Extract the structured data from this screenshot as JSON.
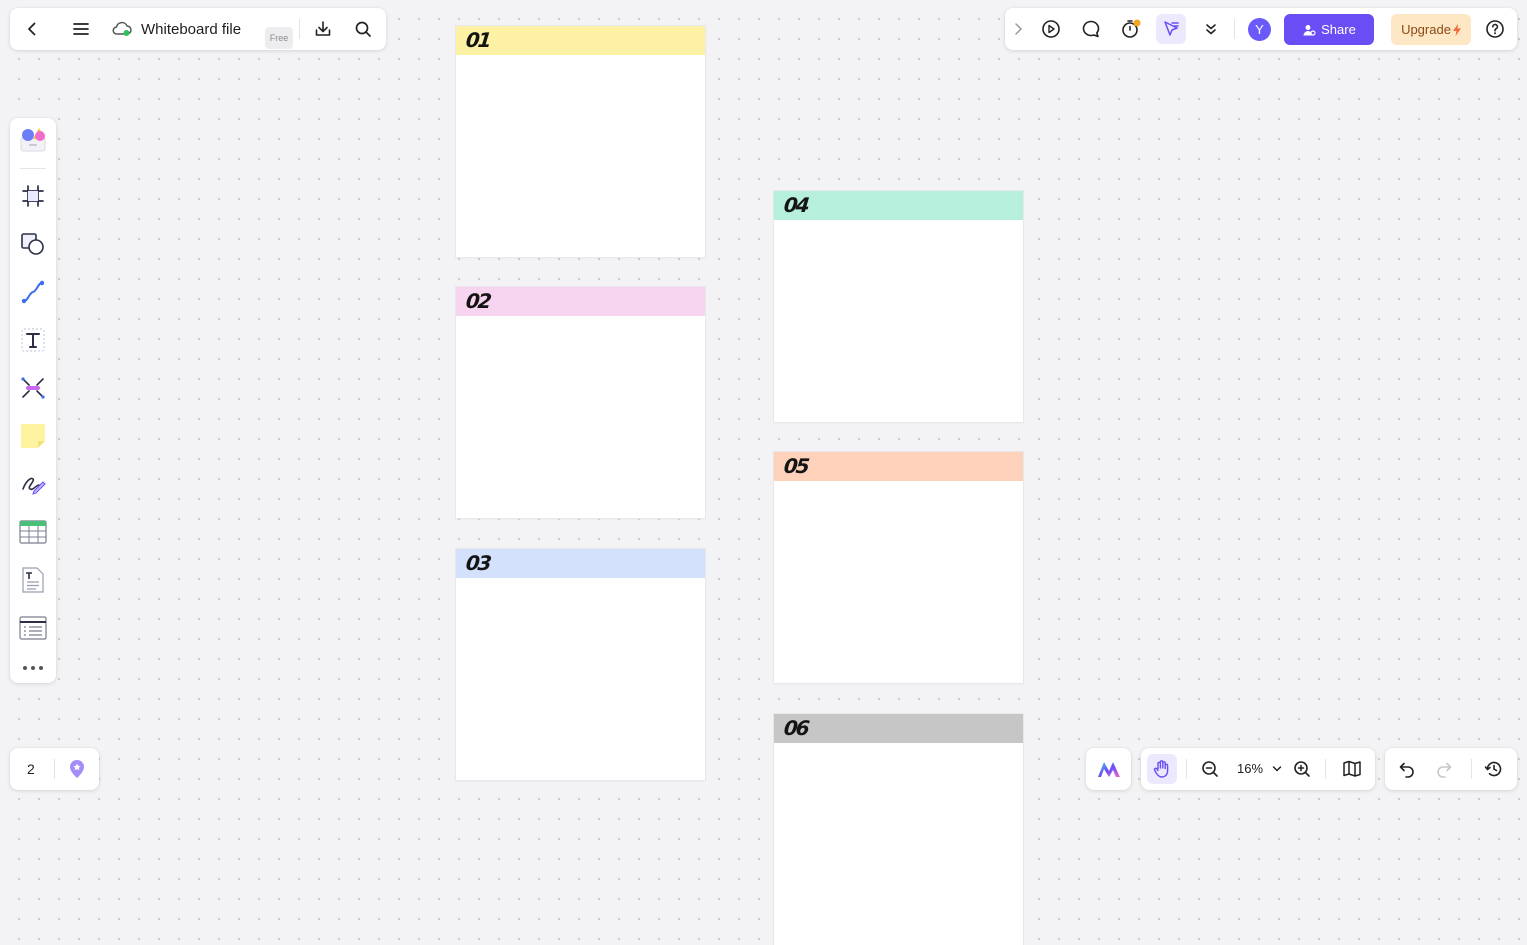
{
  "file": {
    "title": "Whiteboard file",
    "badge": "Free"
  },
  "topbar_right": {
    "avatar_initial": "Y",
    "share_label": "Share",
    "upgrade_label": "Upgrade"
  },
  "pages": {
    "count": "2"
  },
  "zoom": {
    "value": "16%"
  },
  "cards": [
    {
      "number": "01",
      "color": "#fdf1a6"
    },
    {
      "number": "02",
      "color": "#f7d4ef"
    },
    {
      "number": "03",
      "color": "#d3e1fc"
    },
    {
      "number": "04",
      "color": "#b6f0dc"
    },
    {
      "number": "05",
      "color": "#fed2ba"
    },
    {
      "number": "06",
      "color": "#c6c6c6"
    }
  ],
  "colors": {
    "accent": "#6b4df6",
    "avatar": "#6a5af9",
    "upgrade_bg": "#fde7c4"
  }
}
